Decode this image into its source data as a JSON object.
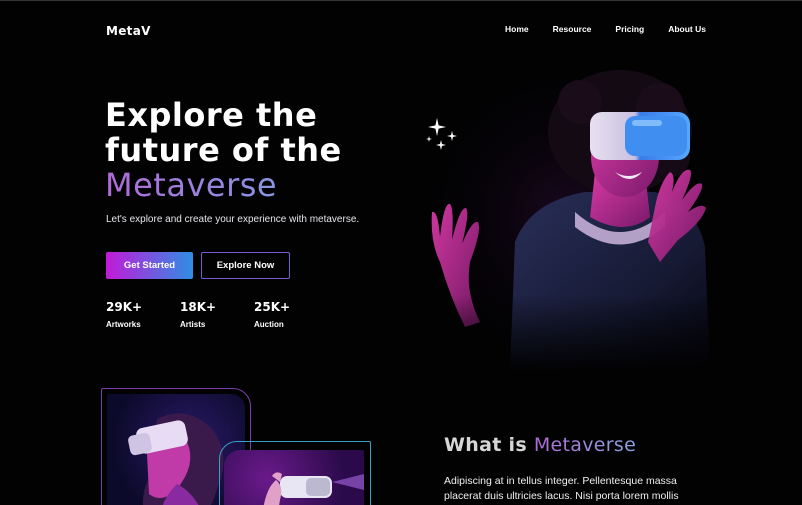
{
  "logo": "MetaV",
  "nav": {
    "items": [
      "Home",
      "Resource",
      "Pricing",
      "About Us"
    ]
  },
  "hero": {
    "title_line1": "Explore the",
    "title_line2": "future of the",
    "title_accent": "Metaverse",
    "subtitle": "Let's explore and create your experience with metaverse.",
    "primary_button": "Get Started",
    "secondary_button": "Explore Now",
    "stats": [
      {
        "value": "29K+",
        "label": "Artworks"
      },
      {
        "value": "18K+",
        "label": "Artists"
      },
      {
        "value": "25K+",
        "label": "Auction"
      }
    ]
  },
  "about": {
    "title_prefix": "What is",
    "title_accent": "Metaverse",
    "body": "Adipiscing at in tellus integer. Pellentesque massa placerat duis ultricies lacus. Nisi porta lorem mollis"
  },
  "icons": {
    "sparkle": "sparkle-icon"
  },
  "colors": {
    "background": "#020203",
    "accent_purple": "#b06ad8",
    "accent_blue": "#2f8ee4",
    "button_gradient_start": "#c21ad8",
    "outline_border": "#7a5ad0"
  }
}
